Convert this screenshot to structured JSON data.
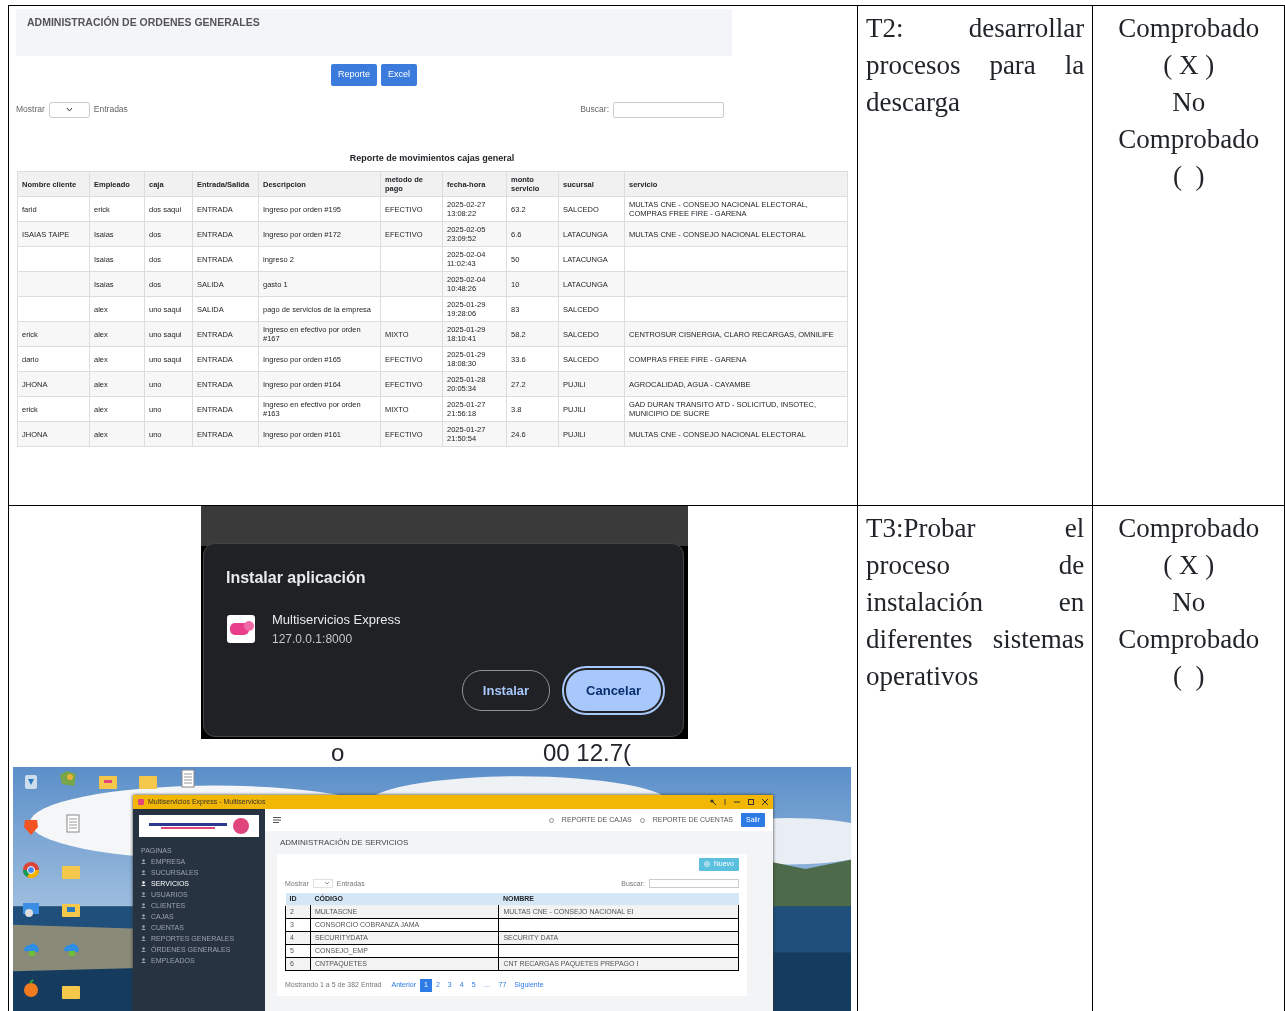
{
  "document_rows": [
    {
      "kind": "report",
      "screenshot": {
        "page_title": "ADMINISTRACIÓN DE ORDENES GENERALES",
        "buttons": [
          "Reporte",
          "Excel"
        ],
        "show_label": "Mostrar",
        "entries_label": "Entradas",
        "search_label": "Buscar:",
        "report_title": "Reporte de movimientos cajas general",
        "columns": [
          "Nombre cliente",
          "Empleado",
          "caja",
          "Entrada/Salida",
          "Descripcion",
          "metodo de pago",
          "fecha-hora",
          "monto servicio",
          "sucursal",
          "servicio"
        ],
        "rows": [
          [
            "farid",
            "erick",
            "dos saqui",
            "ENTRADA",
            "Ingreso por orden #195",
            "EFECTIVO",
            "2025-02-27 13:08:22",
            "63.2",
            "SALCEDO",
            "MULTAS CNE - CONSEJO NACIONAL ELECTORAL, COMPRAS FREE FIRE - GARENA"
          ],
          [
            "ISAIAS TAIPE",
            "Isaias",
            "dos",
            "ENTRADA",
            "Ingreso por orden #172",
            "EFECTIVO",
            "2025-02-05 23:09:52",
            "6.6",
            "LATACUNGA",
            "MULTAS CNE - CONSEJO NACIONAL ELECTORAL"
          ],
          [
            null,
            "Isaias",
            "dos",
            "ENTRADA",
            "ingreso 2",
            null,
            "2025-02-04 11:02:43",
            "50",
            "LATACUNGA",
            null
          ],
          [
            null,
            "Isaias",
            "dos",
            "SALIDA",
            "gasto 1",
            null,
            "2025-02-04 10:48:26",
            "10",
            "LATACUNGA",
            null
          ],
          [
            null,
            "alex",
            "uno saqui",
            "SALIDA",
            "pago de servicios de la empresa",
            null,
            "2025-01-29 19:28:06",
            "83",
            "SALCEDO",
            null
          ],
          [
            "erick",
            "alex",
            "uno saqui",
            "ENTRADA",
            "Ingreso en efectivo por orden #167",
            "MIXTO",
            "2025-01-29 18:10:41",
            "58.2",
            "SALCEDO",
            "CENTROSUR CISNERGIA, CLARO RECARGAS, OMNILIFE"
          ],
          [
            "dario",
            "alex",
            "uno saqui",
            "ENTRADA",
            "Ingreso por orden #165",
            "EFECTIVO",
            "2025-01-29 18:08:30",
            "33.6",
            "SALCEDO",
            "COMPRAS FREE FIRE - GARENA"
          ],
          [
            "JHONA",
            "alex",
            "uno",
            "ENTRADA",
            "Ingreso por orden #164",
            "EFECTIVO",
            "2025-01-28 20:05:34",
            "27.2",
            "PUJILI",
            "AGROCALIDAD, AGUA - CAYAMBE"
          ],
          [
            "erick",
            "alex",
            "uno",
            "ENTRADA",
            "Ingreso en efectivo por orden #163",
            "MIXTO",
            "2025-01-27 21:56:18",
            "3.8",
            "PUJILI",
            "GAD DURAN TRANSITO ATD - SOLICITUD, INSOTEC, MUNICIPIO DE SUCRE"
          ],
          [
            "JHONA",
            "alex",
            "uno",
            "ENTRADA",
            "Ingreso por orden #161",
            "EFECTIVO",
            "2025-01-27 21:50:54",
            "24.6",
            "PUJILI",
            "MULTAS CNE - CONSEJO NACIONAL ELECTORAL"
          ]
        ]
      },
      "task": "T2: desarrollar procesos para la descarga",
      "status_lines": [
        "Comprobado",
        "( X )",
        "No",
        "Comprobado",
        "(  )"
      ]
    },
    {
      "kind": "install",
      "screenshot": {
        "dialog_title": "Instalar aplicación",
        "app_name": "Multiservicios Express",
        "app_url": "127.0.0.1:8000",
        "buttons": [
          {
            "label": "Instalar",
            "focused": false
          },
          {
            "label": "Cancelar",
            "focused": true
          }
        ],
        "cut_texts": [
          "o",
          "00 12.7("
        ],
        "app_window": {
          "title": "Multiservicios Express - Multiservicios",
          "header_links": [
            "REPORTE DE CAJAS",
            "REPORTE DE CUENTAS"
          ],
          "logout": "Salir",
          "sidebar_heading": "PAGINAS",
          "sidebar_items": [
            {
              "label": "EMPRESA",
              "selected": false
            },
            {
              "label": "SUCURSALES",
              "selected": false
            },
            {
              "label": "SERVICIOS",
              "selected": true
            },
            {
              "label": "USUARIOS",
              "selected": false
            },
            {
              "label": "CLIENTES",
              "selected": false
            },
            {
              "label": "CAJAS",
              "selected": false
            },
            {
              "label": "CUENTAS",
              "selected": false
            },
            {
              "label": "REPORTES GENERALES",
              "selected": false
            },
            {
              "label": "ÓRDENES GENERALES",
              "selected": false
            },
            {
              "label": "EMPLEADOS",
              "selected": false
            }
          ],
          "page_title": "ADMINISTRACIÓN DE SERVICIOS",
          "new_button": "Nuevo",
          "show_label": "Mostrar",
          "entries_label": "Entradas",
          "search_label": "Buscar:",
          "columns": [
            "ID",
            "CÓDIGO",
            "NOMBRE"
          ],
          "rows": [
            [
              "2",
              "MULTASCNE",
              "MULTAS CNE - CONSEJO NACIONAL EI"
            ],
            [
              "3",
              "CONSORCIO COBRANZA JAMA",
              null
            ],
            [
              "4",
              "SECURITYDATA",
              "SECURITY DATA"
            ],
            [
              "5",
              "CONSEJO_EMP",
              null
            ],
            [
              "6",
              "CNTPAQUETES",
              "CNT RECARGAS PAQUETES PREPAGO I"
            ]
          ],
          "footer": "Mostrando 1 a 5 de 382 Entrad",
          "pages": [
            {
              "label": "Anterior",
              "selected": false
            },
            {
              "label": "1",
              "selected": true
            },
            {
              "label": "2",
              "selected": false
            },
            {
              "label": "3",
              "selected": false
            },
            {
              "label": "4",
              "selected": false
            },
            {
              "label": "5",
              "selected": false
            },
            {
              "label": "…",
              "selected": false
            },
            {
              "label": "77",
              "selected": false
            },
            {
              "label": "Siguiente",
              "selected": false
            }
          ]
        }
      },
      "task": "T3:Probar el proceso de instalación en diferentes sistemas operativos",
      "status_lines": [
        "Comprobado",
        "( X )",
        "No",
        "Comprobado",
        "(  )"
      ]
    }
  ]
}
